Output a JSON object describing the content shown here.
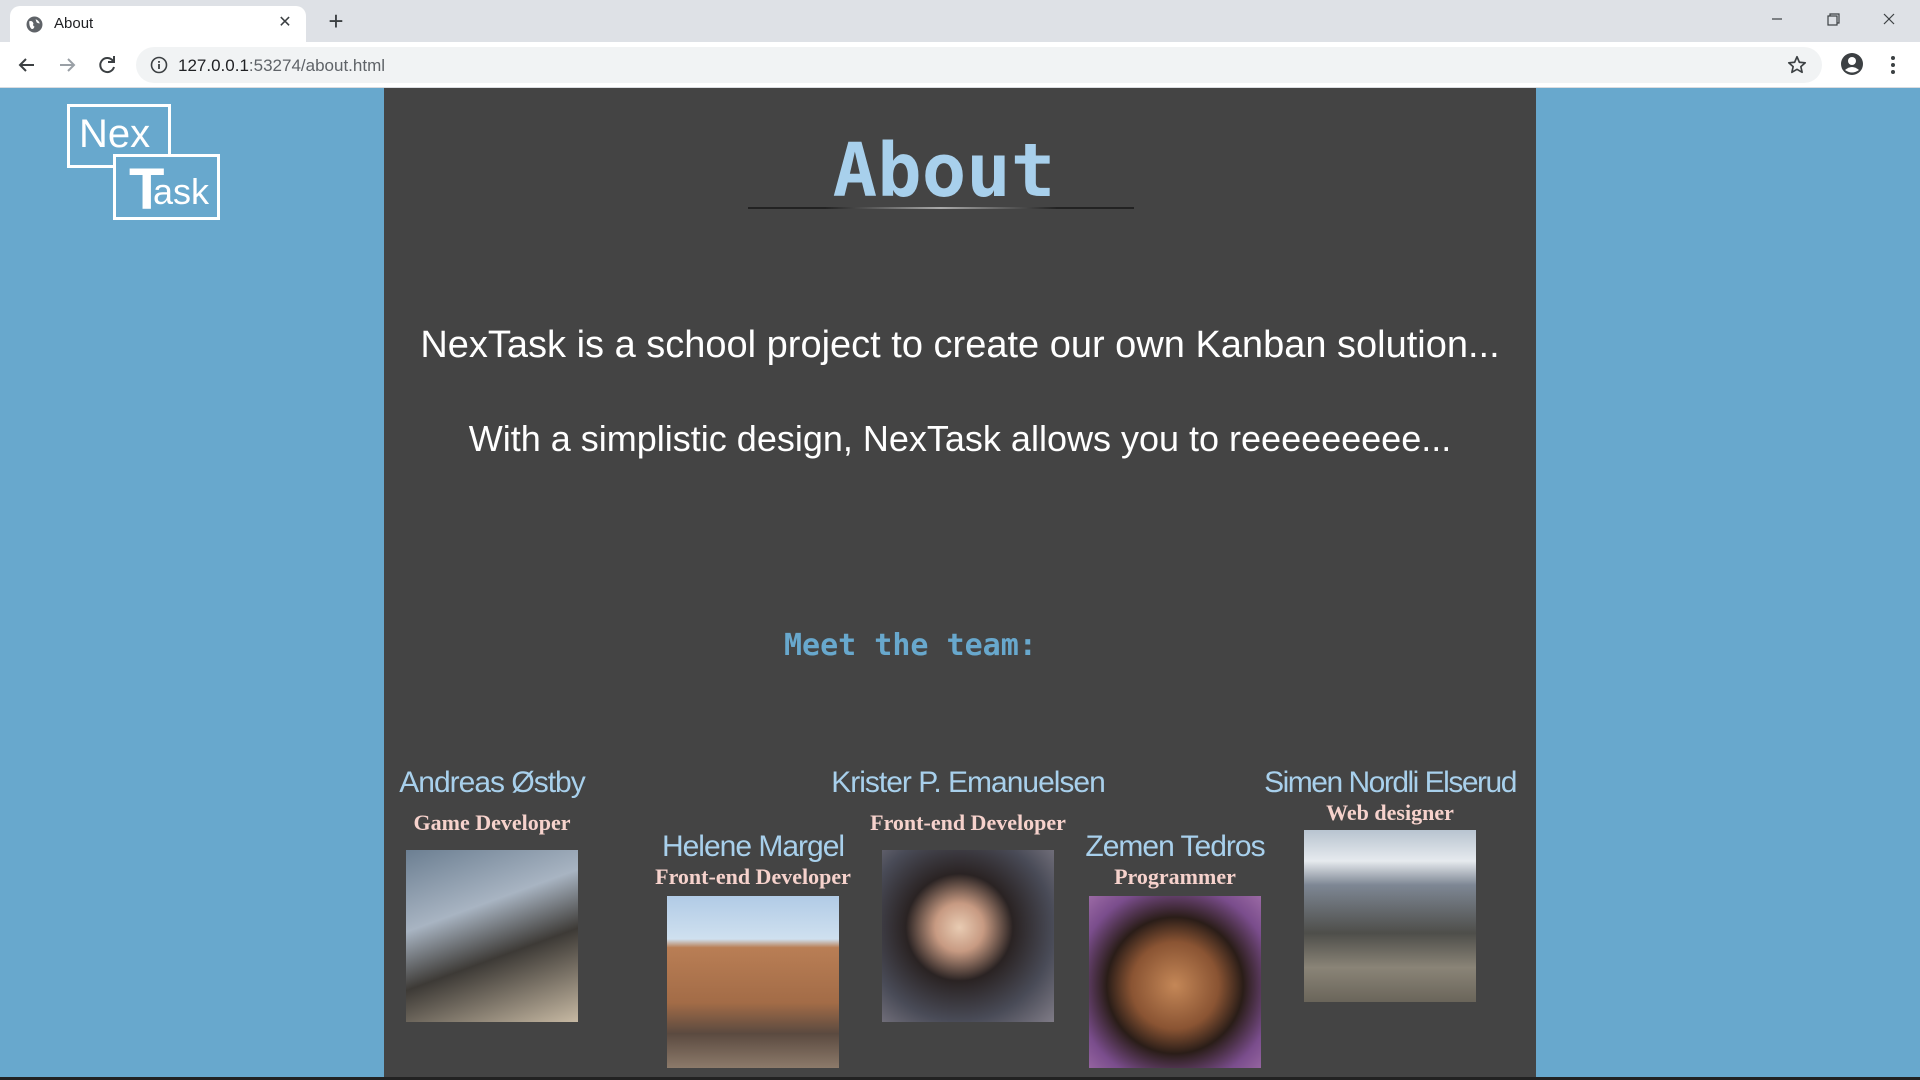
{
  "browser": {
    "tab_title": "About",
    "url_host": "127.0.0.1",
    "url_rest": ":53274/about.html"
  },
  "logo": {
    "line1": "Nex",
    "big_letter": "T",
    "line2": "ask"
  },
  "page": {
    "title": "About",
    "intro_1": "NexTask is a school project to create our own Kanban solution...",
    "intro_2": "With a simplistic design, NexTask allows you to reeeeeeeee...",
    "team_heading": "Meet the team:"
  },
  "team": [
    {
      "name": "Andreas Østby",
      "role": "Game Developer"
    },
    {
      "name": "Helene Margel",
      "role": "Front-end Developer"
    },
    {
      "name": "Krister P. Emanuelsen",
      "role": "Front-end Developer"
    },
    {
      "name": "Zemen Tedros",
      "role": "Programmer"
    },
    {
      "name": "Simen Nordli Elserud",
      "role": "Web designer"
    }
  ],
  "colors": {
    "page_background": "#68a8cd",
    "content_background": "#444444",
    "title": "#a8d0ec",
    "team_heading": "#68a8cd",
    "role_text": "#f6d2cc"
  }
}
